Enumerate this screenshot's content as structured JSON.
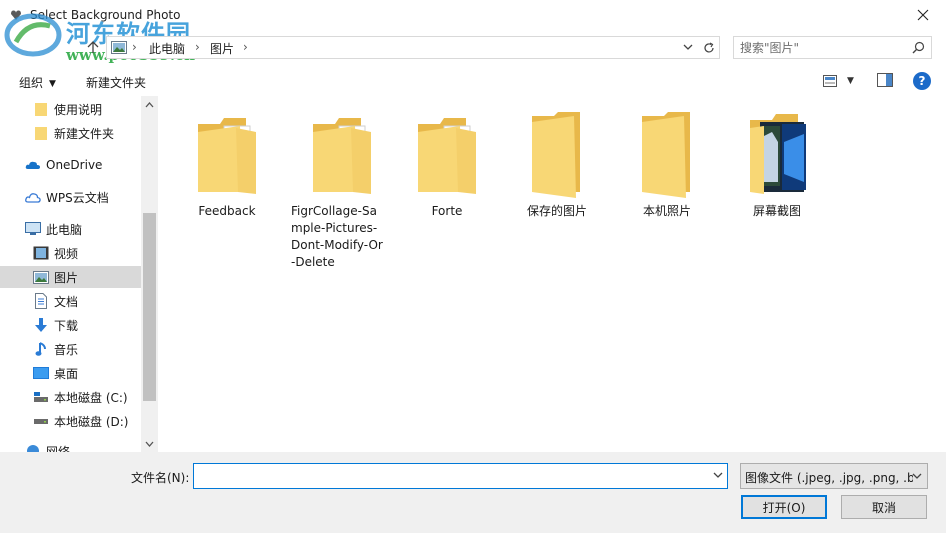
{
  "window": {
    "title": "Select Background Photo"
  },
  "watermark": {
    "text": "河东软件园",
    "url": "www.pc0359.cn"
  },
  "address": {
    "crumbs": [
      "此电脑",
      "图片"
    ]
  },
  "search": {
    "placeholder": "搜索\"图片\""
  },
  "toolbar": {
    "organize_label": "组织",
    "new_folder_label": "新建文件夹",
    "help_label": "?"
  },
  "nav": {
    "items": [
      {
        "label": "使用说明",
        "icon": "folder-icon"
      },
      {
        "label": "新建文件夹",
        "icon": "folder-icon"
      },
      {
        "label": "OneDrive",
        "icon": "cloud-icon"
      },
      {
        "label": "WPS云文档",
        "icon": "wps-cloud-icon"
      },
      {
        "label": "此电脑",
        "icon": "computer-icon"
      },
      {
        "label": "视频",
        "icon": "video-icon"
      },
      {
        "label": "图片",
        "icon": "pictures-icon",
        "selected": true
      },
      {
        "label": "文档",
        "icon": "document-icon"
      },
      {
        "label": "下载",
        "icon": "download-icon"
      },
      {
        "label": "音乐",
        "icon": "music-icon"
      },
      {
        "label": "桌面",
        "icon": "desktop-icon"
      },
      {
        "label": "本地磁盘 (C:)",
        "icon": "drive-c-icon"
      },
      {
        "label": "本地磁盘 (D:)",
        "icon": "drive-icon"
      },
      {
        "label": "网络",
        "icon": "network-icon"
      }
    ]
  },
  "files": [
    {
      "name": "Feedback",
      "icon": "folder-with-docs-icon"
    },
    {
      "name": "FigrCollage-Sample-Pictures-Dont-Modify-Or-Delete",
      "icon": "folder-with-docs-icon"
    },
    {
      "name": "Forte",
      "icon": "folder-with-docs-icon"
    },
    {
      "name": "保存的图片",
      "icon": "folder-icon"
    },
    {
      "name": "本机照片",
      "icon": "folder-icon"
    },
    {
      "name": "屏幕截图",
      "icon": "folder-with-photos-icon"
    }
  ],
  "footer": {
    "filename_label": "文件名(N):",
    "filename_value": "",
    "filetype_value": "图像文件 (.jpeg, .jpg, .png, .b",
    "open_label": "打开(O)",
    "cancel_label": "取消"
  },
  "colors": {
    "accent": "#0078d7",
    "folder": "#f8d775",
    "selected": "#d9d9d9",
    "footer_bg": "#f0f0f0"
  }
}
